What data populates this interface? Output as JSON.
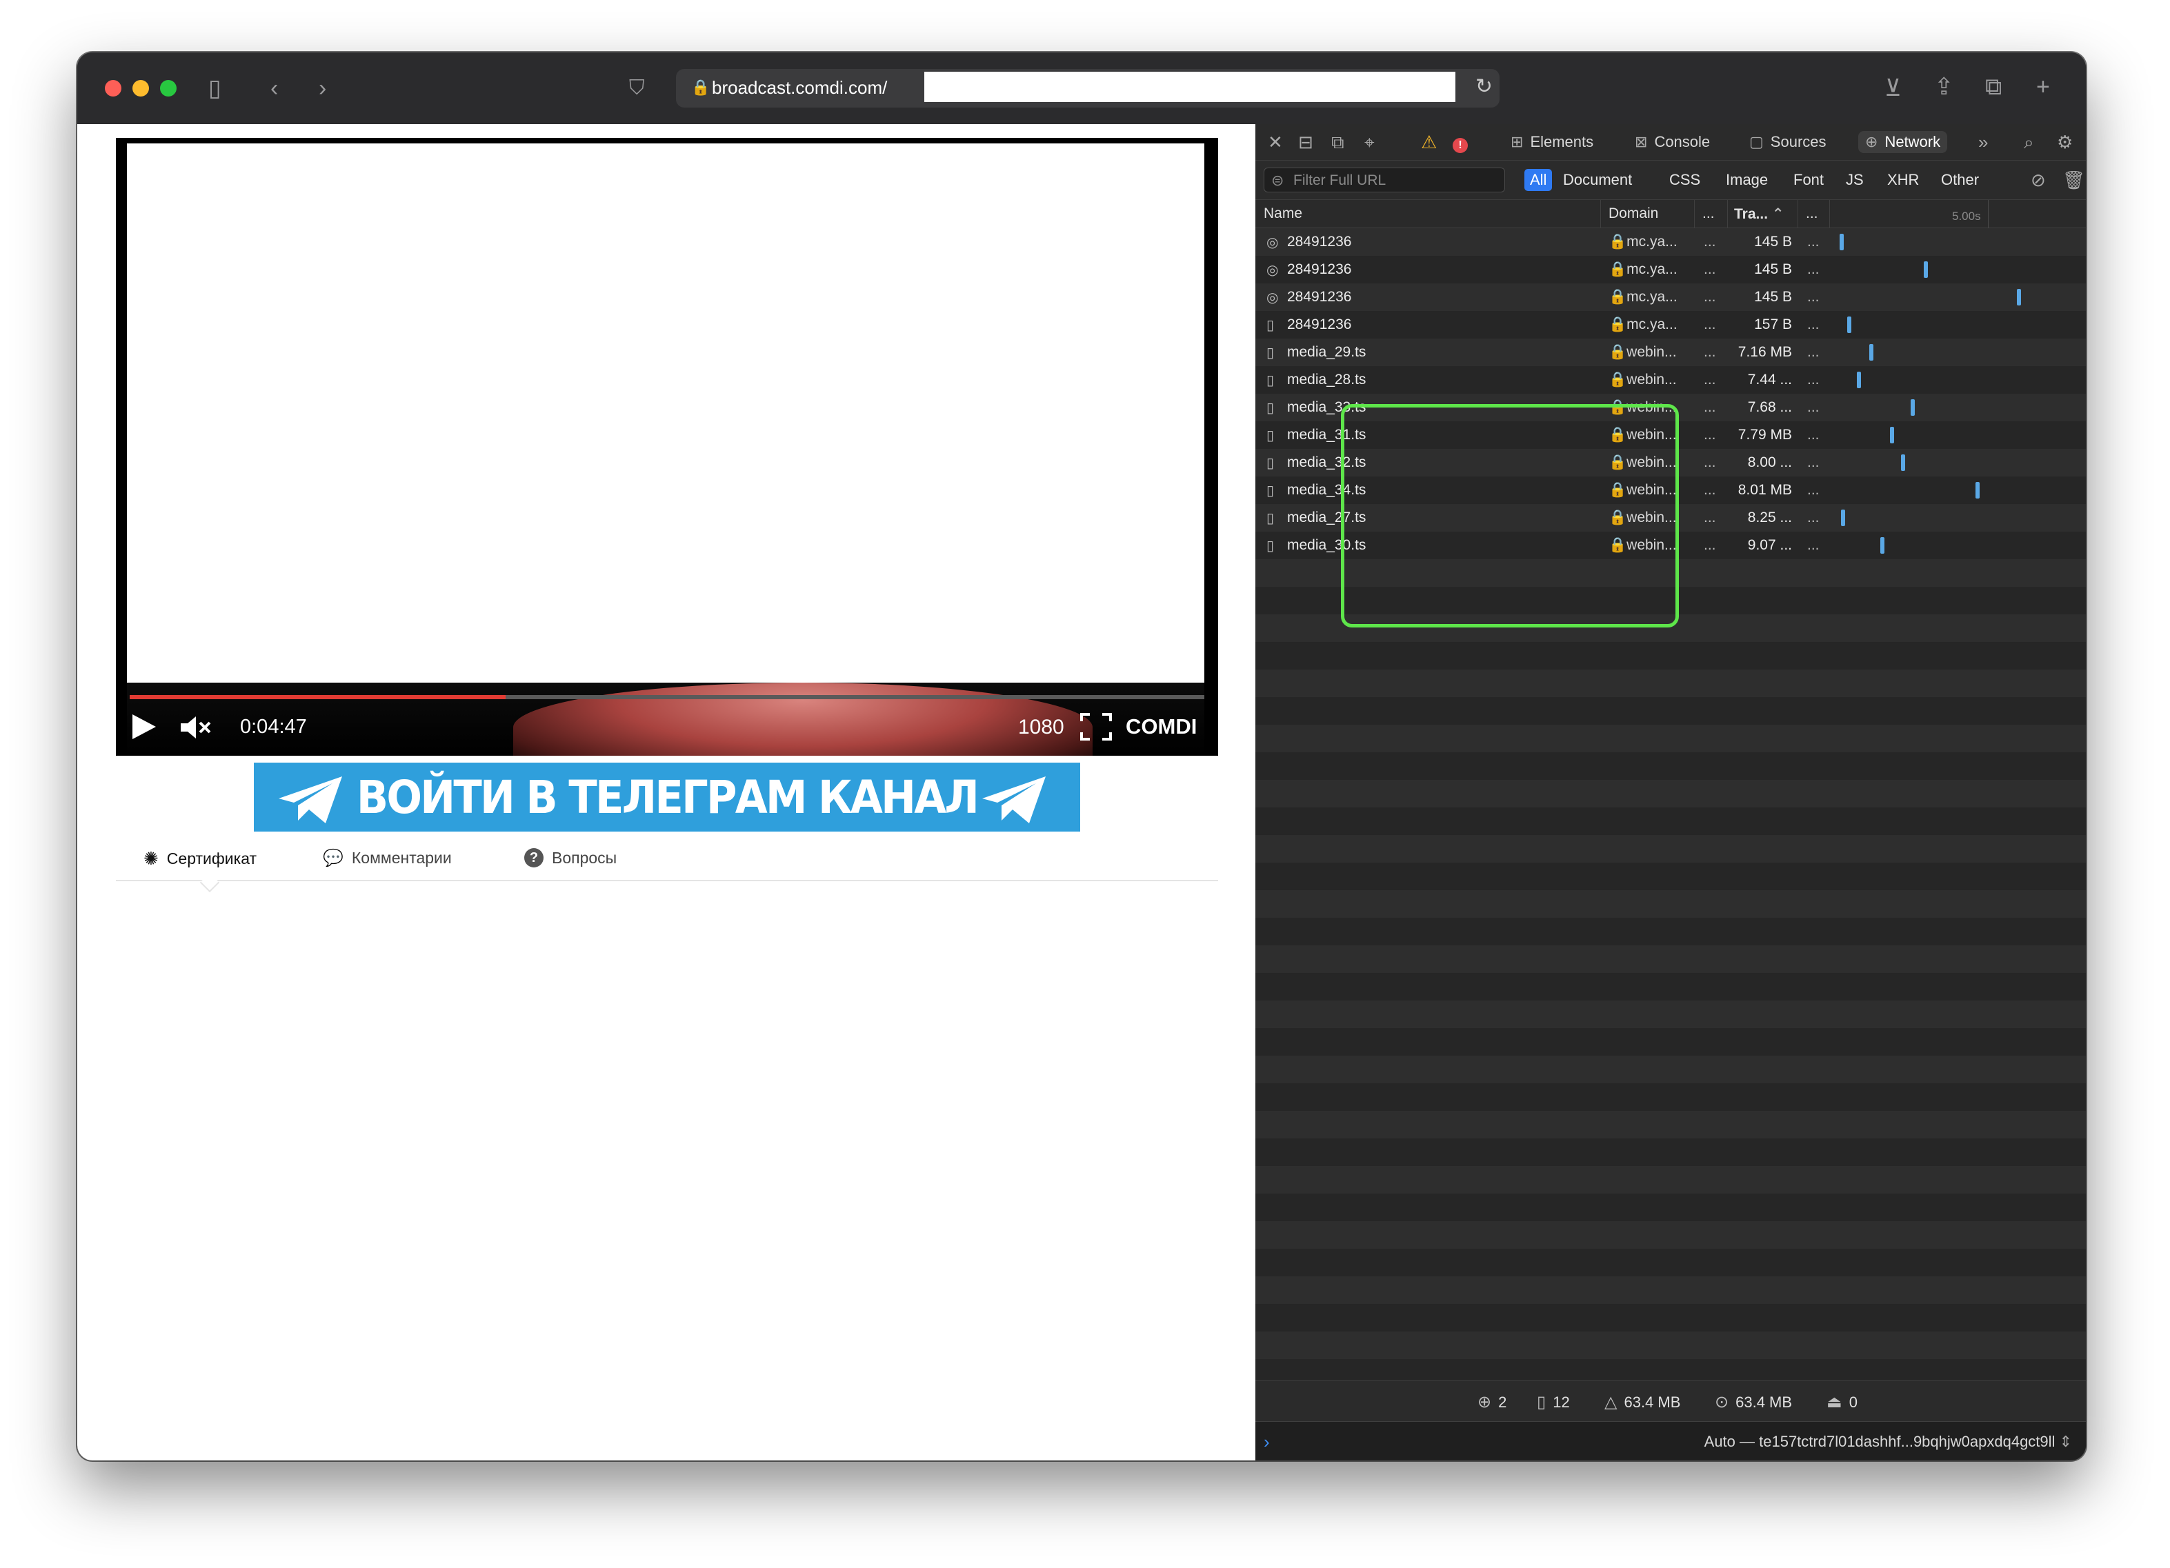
{
  "browser": {
    "url": "broadcast.comdi.com/",
    "icons": [
      "sidebar-icon",
      "back-icon",
      "forward-icon",
      "shield-icon",
      "lock-icon",
      "reload-icon",
      "download-icon",
      "share-icon",
      "tabs-icon",
      "new-tab-icon"
    ]
  },
  "player": {
    "time": "0:04:47",
    "quality": "1080",
    "brand": "COMDI",
    "progress_fraction": 0.35
  },
  "banner": {
    "text": "ВОЙТИ В ТЕЛЕГРАМ КАНАЛ"
  },
  "page_tabs": [
    {
      "label": "Сертификат",
      "active": true
    },
    {
      "label": "Комментарии",
      "active": false
    },
    {
      "label": "Вопросы",
      "active": false
    }
  ],
  "devtools": {
    "tabs": [
      {
        "label": "Elements",
        "active": false
      },
      {
        "label": "Console",
        "active": false
      },
      {
        "label": "Sources",
        "active": false
      },
      {
        "label": "Network",
        "active": true
      }
    ],
    "filter_placeholder": "Filter Full URL",
    "types": [
      "All",
      "Document",
      "CSS",
      "Image",
      "Font",
      "JS",
      "XHR",
      "Other"
    ],
    "active_type": "All",
    "columns": {
      "name": "Name",
      "domain": "Domain",
      "dots1": "...",
      "transferred": "Tra...",
      "dots2": "...",
      "timeline_tick": "5.00s"
    },
    "requests": [
      {
        "name": "28491236",
        "domain": "mc.ya...",
        "dots": "...",
        "transferred": "145 B",
        "more": "...",
        "icon": "beacon-icon",
        "wf_start": 0.02
      },
      {
        "name": "28491236",
        "domain": "mc.ya...",
        "dots": "...",
        "transferred": "145 B",
        "more": "...",
        "icon": "beacon-icon",
        "wf_start": 0.55
      },
      {
        "name": "28491236",
        "domain": "mc.ya...",
        "dots": "...",
        "transferred": "145 B",
        "more": "...",
        "icon": "beacon-icon",
        "wf_start": 1.14
      },
      {
        "name": "28491236",
        "domain": "mc.ya...",
        "dots": "...",
        "transferred": "157 B",
        "more": "...",
        "icon": "file-icon",
        "wf_start": 0.07
      },
      {
        "name": "media_29.ts",
        "domain": "webin...",
        "dots": "...",
        "transferred": "7.16 MB",
        "more": "...",
        "icon": "file-icon",
        "wf_start": 0.21
      },
      {
        "name": "media_28.ts",
        "domain": "webin...",
        "dots": "...",
        "transferred": "7.44 ...",
        "more": "...",
        "icon": "file-icon",
        "wf_start": 0.13
      },
      {
        "name": "media_33.ts",
        "domain": "webin...",
        "dots": "...",
        "transferred": "7.68 ...",
        "more": "...",
        "icon": "file-icon",
        "wf_start": 0.47
      },
      {
        "name": "media_31.ts",
        "domain": "webin...",
        "dots": "...",
        "transferred": "7.79 MB",
        "more": "...",
        "icon": "file-icon",
        "wf_start": 0.34
      },
      {
        "name": "media_32.ts",
        "domain": "webin...",
        "dots": "...",
        "transferred": "8.00 ...",
        "more": "...",
        "icon": "file-icon",
        "wf_start": 0.41
      },
      {
        "name": "media_34.ts",
        "domain": "webin...",
        "dots": "...",
        "transferred": "8.01 MB",
        "more": "...",
        "icon": "file-icon",
        "wf_start": 0.88
      },
      {
        "name": "media_27.ts",
        "domain": "webin...",
        "dots": "...",
        "transferred": "8.25 ...",
        "more": "...",
        "icon": "file-icon",
        "wf_start": 0.03
      },
      {
        "name": "media_30.ts",
        "domain": "webin...",
        "dots": "...",
        "transferred": "9.07 ...",
        "more": "...",
        "icon": "file-icon",
        "wf_start": 0.28
      }
    ],
    "status": {
      "domains": "2",
      "resources": "12",
      "transferred": "63.4 MB",
      "size": "63.4 MB",
      "errors": "0"
    },
    "console_context": "Auto — te157tctrd7l01dashhf...9bqhjw0apxdq4gct9ll",
    "colors": {
      "accent": "#2f7af2",
      "highlight": "#5ee64a",
      "waterfall": "#5aa8e6"
    }
  }
}
